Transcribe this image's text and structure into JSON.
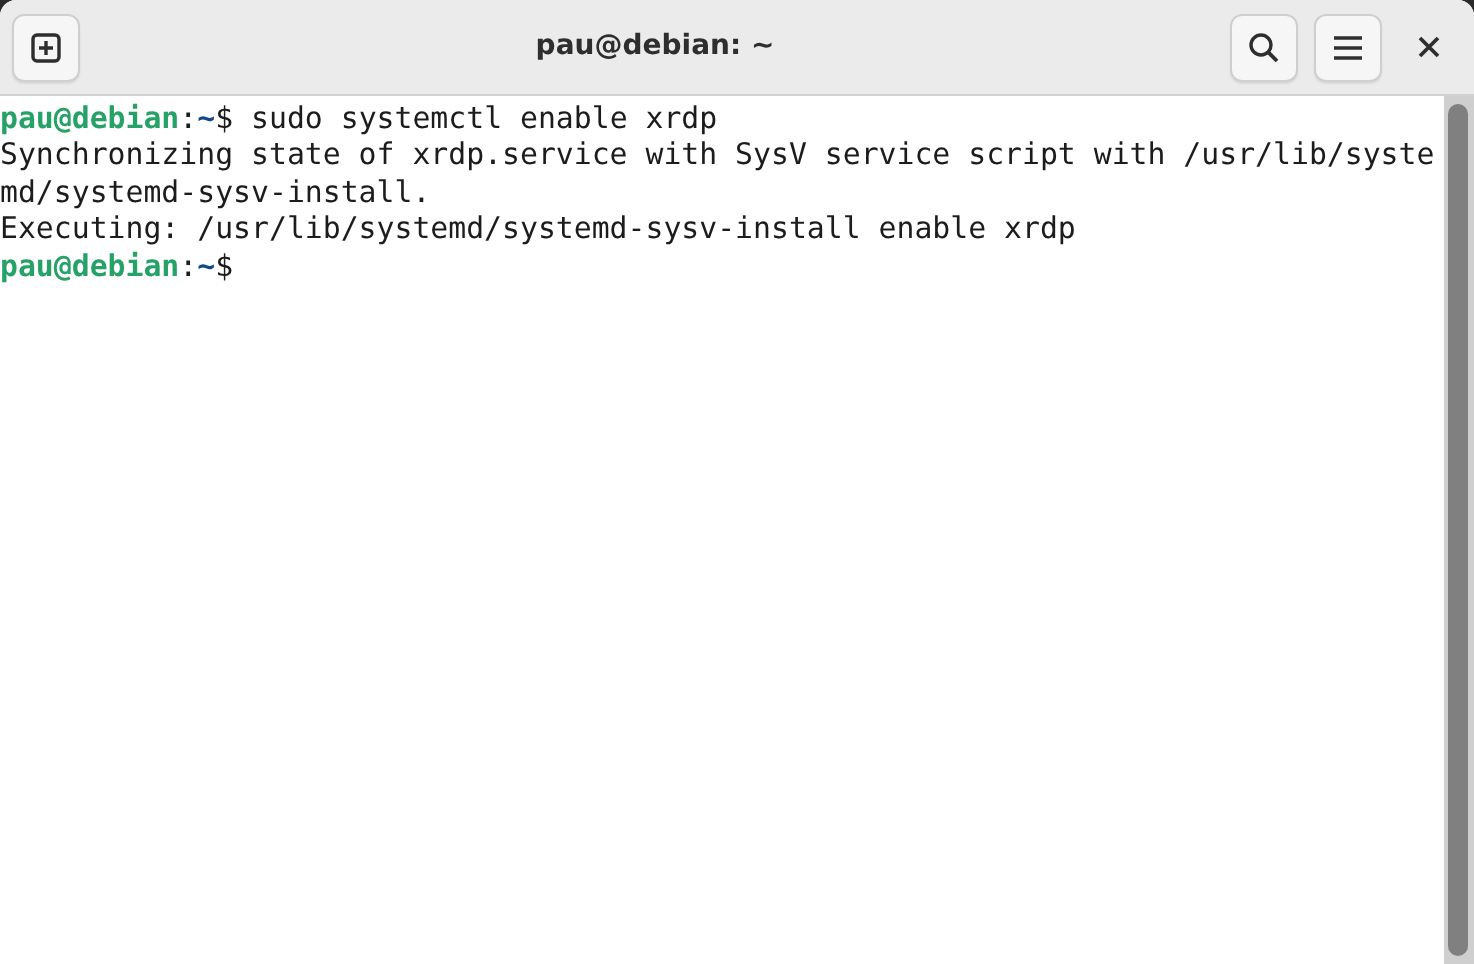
{
  "window": {
    "title": "pau@debian: ~"
  },
  "terminal": {
    "lines": [
      {
        "kind": "prompt",
        "user_host": "pau@debian",
        "separator": ":",
        "path": "~",
        "symbol": "$",
        "command": " sudo systemctl enable xrdp"
      },
      {
        "kind": "output",
        "text": "Synchronizing state of xrdp.service with SysV service script with /usr/lib/syste"
      },
      {
        "kind": "output",
        "text": "md/systemd-sysv-install."
      },
      {
        "kind": "output",
        "text": "Executing: /usr/lib/systemd/systemd-sysv-install enable xrdp"
      },
      {
        "kind": "prompt",
        "user_host": "pau@debian",
        "separator": ":",
        "path": "~",
        "symbol": "$"
      }
    ]
  }
}
